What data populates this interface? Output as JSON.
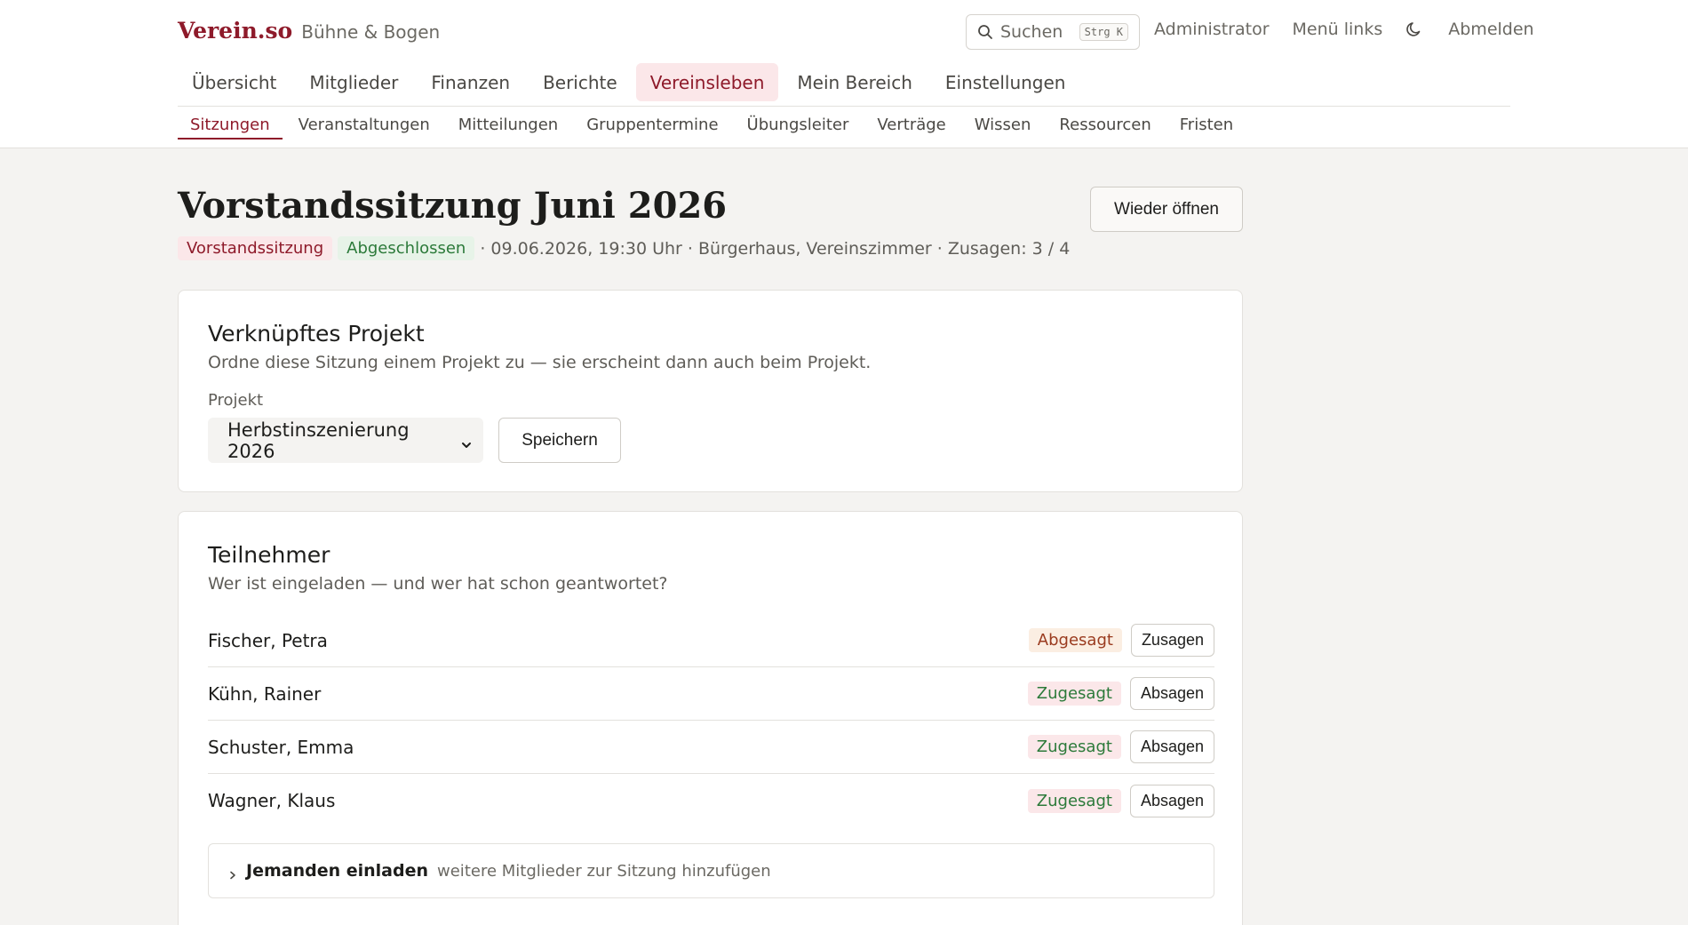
{
  "header": {
    "logo": "Verein.so",
    "org_name": "Bühne & Bogen",
    "search_label": "Suchen",
    "search_shortcut": "Strg K",
    "links": [
      "Administrator",
      "Menü links",
      "Abmelden"
    ]
  },
  "main_nav": [
    "Übersicht",
    "Mitglieder",
    "Finanzen",
    "Berichte",
    "Vereinsleben",
    "Mein Bereich",
    "Einstellungen"
  ],
  "main_nav_active": "Vereinsleben",
  "sub_nav": [
    "Sitzungen",
    "Veranstaltungen",
    "Mitteilungen",
    "Gruppentermine",
    "Übungsleiter",
    "Verträge",
    "Wissen",
    "Ressourcen",
    "Fristen"
  ],
  "sub_nav_active": "Sitzungen",
  "meeting": {
    "title": "Vorstandssitzung Juni 2026",
    "type_badge": "Vorstandssitzung",
    "status_badge": "Abgeschlossen",
    "meta": "· 09.06.2026, 19:30 Uhr · Bürgerhaus, Vereinszimmer · Zusagen: 3 / 4",
    "reopen_label": "Wieder öffnen"
  },
  "project_card": {
    "title": "Verknüpftes Projekt",
    "description": "Ordne diese Sitzung einem Projekt zu — sie erscheint dann auch beim Projekt.",
    "field_label": "Projekt",
    "selected_project": "Herbstinszenierung 2026",
    "save_label": "Speichern"
  },
  "participants_card": {
    "title": "Teilnehmer",
    "description": "Wer ist eingeladen — und wer hat schon geantwortet?",
    "participants": [
      {
        "name": "Fischer, Petra",
        "status": "Abgesagt",
        "action": "Zusagen"
      },
      {
        "name": "Kühn, Rainer",
        "status": "Zugesagt",
        "action": "Absagen"
      },
      {
        "name": "Schuster, Emma",
        "status": "Zugesagt",
        "action": "Absagen"
      },
      {
        "name": "Wagner, Klaus",
        "status": "Zugesagt",
        "action": "Absagen"
      }
    ],
    "invite_title": "Jemanden einladen",
    "invite_hint": "weitere Mitglieder zur Sitzung hinzufügen"
  },
  "colors": {
    "accent": "#8e1a2a",
    "accent_bg": "#fbe7e9",
    "success": "#2c7a3a",
    "declined": "#9a3b1f"
  }
}
